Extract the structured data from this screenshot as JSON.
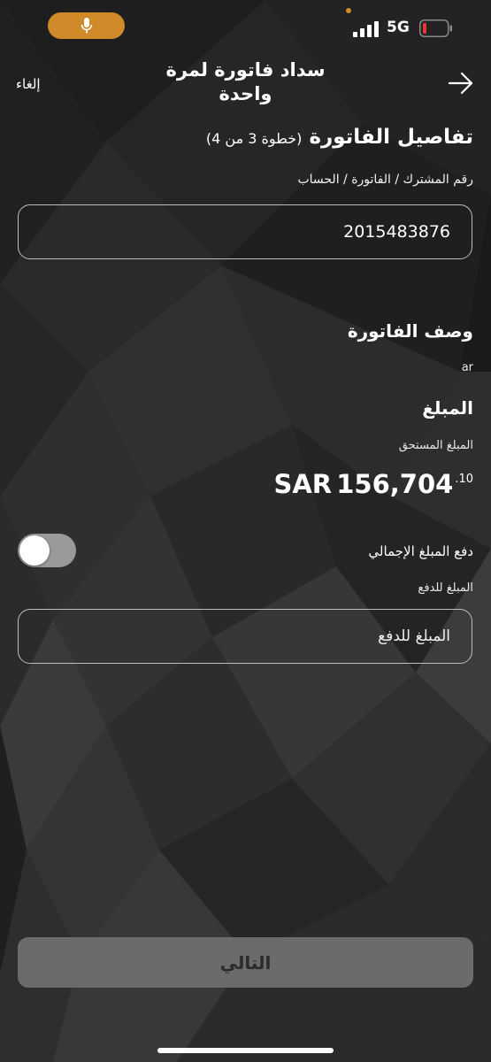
{
  "status_bar": {
    "network": "5G"
  },
  "header": {
    "cancel": "إلغاء",
    "title": "سداد فاتورة لمرة واحدة"
  },
  "section": {
    "title": "تفاصيل الفاتورة",
    "step": "(خطوة 3 من 4)"
  },
  "account": {
    "label": "رقم المشترك / الفاتورة / الحساب",
    "value": "2015483876"
  },
  "bill_description": {
    "title": "وصف الفاتورة",
    "value": "ar"
  },
  "amount": {
    "title": "المبلغ",
    "due_label": "المبلغ المستحق",
    "currency": "SAR",
    "value": "156,704",
    "decimals": ".10"
  },
  "full_amount": {
    "label": "دفع المبلغ الإجمالي",
    "enabled": false
  },
  "payment_amount": {
    "label": "المبلغ للدفع",
    "placeholder": "المبلغ للدفع"
  },
  "next_button": {
    "label": "التالي"
  },
  "colors": {
    "accent": "#d08a2a",
    "battery_low": "#e53935",
    "background": "#1b1b1b"
  }
}
